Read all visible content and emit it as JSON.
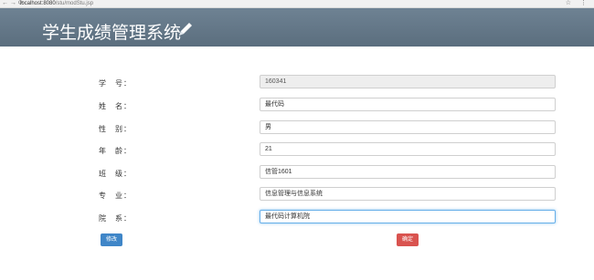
{
  "browser": {
    "nav_glyphs": "← → ⟳",
    "url_host": "localhost:8080",
    "url_path": "/stu/modStu.jsp",
    "tools": "☆ ⋮"
  },
  "header": {
    "title": "学生成绩管理系统",
    "icon": "pencil-icon",
    "background": "#647888"
  },
  "form": {
    "fields": [
      {
        "label": "学　号：",
        "value": "160341"
      },
      {
        "label": "姓　名：",
        "value": "最代码"
      },
      {
        "label": "性　别：",
        "value": "男"
      },
      {
        "label": "年　龄：",
        "value": "21"
      },
      {
        "label": "班　级：",
        "value": "信管1601"
      },
      {
        "label": "专　业：",
        "value": "信息管理与信息系统"
      },
      {
        "label": "院　系：",
        "value": "最代码计算机院"
      }
    ]
  },
  "buttons": {
    "edit_label": "修改",
    "confirm_label": "确定",
    "edit_color": "#3f86c8",
    "confirm_color": "#d9534f"
  }
}
